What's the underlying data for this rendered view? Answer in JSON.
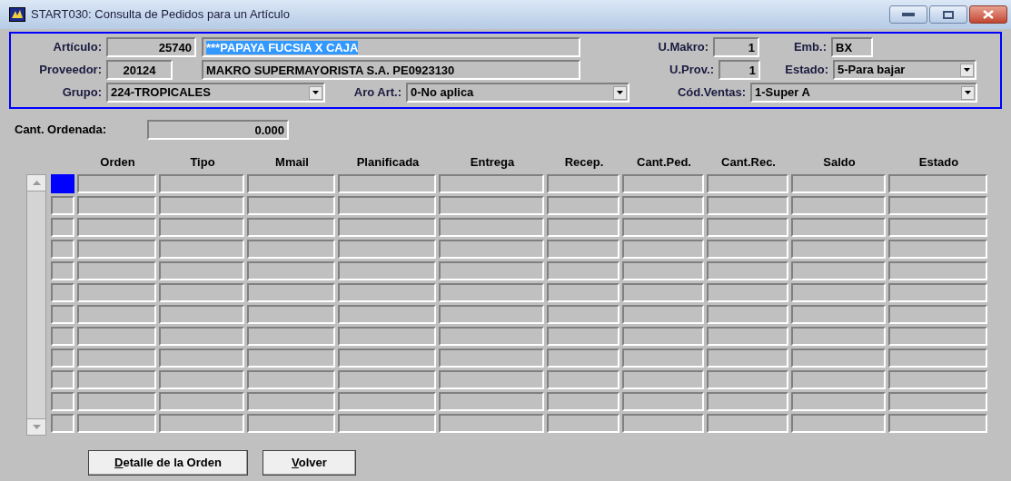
{
  "window": {
    "title": "START030: Consulta de Pedidos para un Artículo"
  },
  "header": {
    "articulo": {
      "label": "Artículo:",
      "code": "25740",
      "description": "***PAPAYA FUCSIA X CAJA",
      "description_highlighted": true
    },
    "u_makro": {
      "label": "U.Makro:",
      "value": "1"
    },
    "emb": {
      "label": "Emb.:",
      "value": "BX"
    },
    "proveedor": {
      "label": "Proveedor:",
      "code": "20124",
      "description": "MAKRO SUPERMAYORISTA S.A. PE0923130"
    },
    "u_prov": {
      "label": "U.Prov.:",
      "value": "1"
    },
    "estado": {
      "label": "Estado:",
      "value": "5-Para bajar"
    },
    "grupo": {
      "label": "Grupo:",
      "value": "224-TROPICALES"
    },
    "aro_art": {
      "label": "Aro Art.:",
      "value": "0-No aplica"
    },
    "cod_ventas": {
      "label": "Cód.Ventas:",
      "value": "1-Super A"
    }
  },
  "cant_ordenada": {
    "label": "Cant. Ordenada:",
    "value": "0.000"
  },
  "grid": {
    "columns": [
      "Orden",
      "Tipo",
      "Mmail",
      "Planificada",
      "Entrega",
      "Recep.",
      "Cant.Ped.",
      "Cant.Rec.",
      "Saldo",
      "Estado"
    ],
    "rows": [
      {
        "selected": true
      },
      {
        "selected": false
      },
      {
        "selected": false
      },
      {
        "selected": false
      },
      {
        "selected": false
      },
      {
        "selected": false
      },
      {
        "selected": false
      },
      {
        "selected": false
      },
      {
        "selected": false
      },
      {
        "selected": false
      },
      {
        "selected": false
      },
      {
        "selected": false
      }
    ]
  },
  "buttons": [
    {
      "label": "Detalle de la Orden"
    },
    {
      "label": "Volver"
    }
  ]
}
